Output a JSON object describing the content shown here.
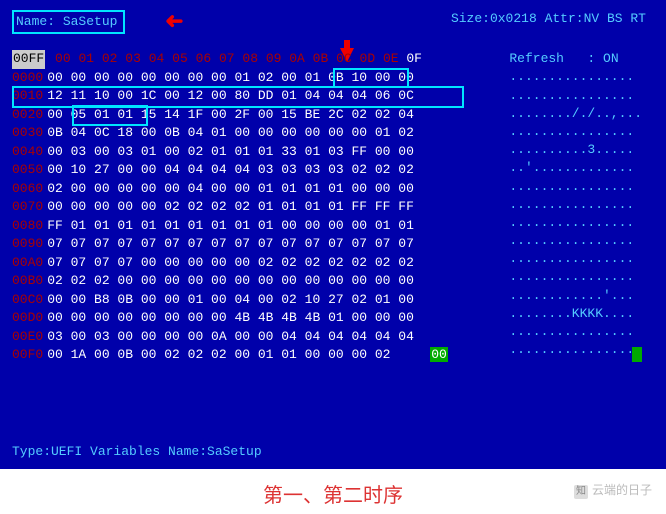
{
  "header": {
    "name_label": "Name:",
    "name_value": "SaSetup",
    "size_attr": "Size:0x0218 Attr:NV BS RT"
  },
  "columns_head_offset": "00FF",
  "columns": [
    "00",
    "01",
    "02",
    "03",
    "04",
    "05",
    "06",
    "07",
    "08",
    "09",
    "0A",
    "0B",
    "0C",
    "0D",
    "0E",
    "0F"
  ],
  "refresh": {
    "label": "Refresh",
    "sep": ":",
    "value": "ON"
  },
  "rows": [
    {
      "offset": "0000",
      "bytes": [
        "00",
        "00",
        "00",
        "00",
        "00",
        "00",
        "00",
        "00",
        "01",
        "02",
        "00",
        "01",
        "0B",
        "10",
        "00",
        "00"
      ],
      "ascii": "................"
    },
    {
      "offset": "0010",
      "bytes": [
        "12",
        "11",
        "10",
        "00",
        "1C",
        "00",
        "12",
        "00",
        "80",
        "DD",
        "01",
        "04",
        "04",
        "04",
        "06",
        "0C"
      ],
      "ascii": "................"
    },
    {
      "offset": "0020",
      "bytes": [
        "00",
        "05",
        "01",
        "01",
        "15",
        "14",
        "1F",
        "00",
        "2F",
        "00",
        "15",
        "BE",
        "2C",
        "02",
        "02",
        "04"
      ],
      "ascii": ".......././..,..."
    },
    {
      "offset": "0030",
      "bytes": [
        "0B",
        "04",
        "0C",
        "18",
        "00",
        "0B",
        "04",
        "01",
        "00",
        "00",
        "00",
        "00",
        "00",
        "00",
        "01",
        "02"
      ],
      "ascii": "................"
    },
    {
      "offset": "0040",
      "bytes": [
        "00",
        "03",
        "00",
        "03",
        "01",
        "00",
        "02",
        "01",
        "01",
        "01",
        "33",
        "01",
        "03",
        "FF",
        "00",
        "00"
      ],
      "ascii": "..........3....."
    },
    {
      "offset": "0050",
      "bytes": [
        "00",
        "10",
        "27",
        "00",
        "00",
        "04",
        "04",
        "04",
        "04",
        "03",
        "03",
        "03",
        "03",
        "02",
        "02",
        "02"
      ],
      "ascii": "..'............."
    },
    {
      "offset": "0060",
      "bytes": [
        "02",
        "00",
        "00",
        "00",
        "00",
        "00",
        "04",
        "00",
        "00",
        "01",
        "01",
        "01",
        "01",
        "00",
        "00",
        "00"
      ],
      "ascii": "................"
    },
    {
      "offset": "0070",
      "bytes": [
        "00",
        "00",
        "00",
        "00",
        "00",
        "02",
        "02",
        "02",
        "02",
        "01",
        "01",
        "01",
        "01",
        "FF",
        "FF",
        "FF"
      ],
      "ascii": "................"
    },
    {
      "offset": "0080",
      "bytes": [
        "FF",
        "01",
        "01",
        "01",
        "01",
        "01",
        "01",
        "01",
        "01",
        "01",
        "00",
        "00",
        "00",
        "00",
        "01",
        "01"
      ],
      "ascii": "................"
    },
    {
      "offset": "0090",
      "bytes": [
        "07",
        "07",
        "07",
        "07",
        "07",
        "07",
        "07",
        "07",
        "07",
        "07",
        "07",
        "07",
        "07",
        "07",
        "07",
        "07"
      ],
      "ascii": "................"
    },
    {
      "offset": "00A0",
      "bytes": [
        "07",
        "07",
        "07",
        "07",
        "00",
        "00",
        "00",
        "00",
        "00",
        "02",
        "02",
        "02",
        "02",
        "02",
        "02",
        "02"
      ],
      "ascii": "................"
    },
    {
      "offset": "00B0",
      "bytes": [
        "02",
        "02",
        "02",
        "00",
        "00",
        "00",
        "00",
        "00",
        "00",
        "00",
        "00",
        "00",
        "00",
        "00",
        "00",
        "00"
      ],
      "ascii": "................"
    },
    {
      "offset": "00C0",
      "bytes": [
        "00",
        "00",
        "B8",
        "0B",
        "00",
        "00",
        "01",
        "00",
        "04",
        "00",
        "02",
        "10",
        "27",
        "02",
        "01",
        "00"
      ],
      "ascii": "............'..."
    },
    {
      "offset": "00D0",
      "bytes": [
        "00",
        "00",
        "00",
        "00",
        "00",
        "00",
        "00",
        "00",
        "4B",
        "4B",
        "4B",
        "4B",
        "01",
        "00",
        "00",
        "00"
      ],
      "ascii": "........KKKK...."
    },
    {
      "offset": "00E0",
      "bytes": [
        "03",
        "00",
        "03",
        "00",
        "00",
        "00",
        "00",
        "0A",
        "00",
        "00",
        "04",
        "04",
        "04",
        "04",
        "04",
        "04"
      ],
      "ascii": "................"
    },
    {
      "offset": "00F0",
      "bytes": [
        "00",
        "1A",
        "00",
        "0B",
        "00",
        "02",
        "02",
        "02",
        "00",
        "01",
        "01",
        "00",
        "00",
        "00",
        "02",
        "00"
      ],
      "ascii": "................"
    }
  ],
  "green_last_byte": "00",
  "footer": "Type:UEFI Variables  Name:SaSetup",
  "caption": "第一、第二时序",
  "watermark": "云端的日子",
  "wm_logo": "知"
}
